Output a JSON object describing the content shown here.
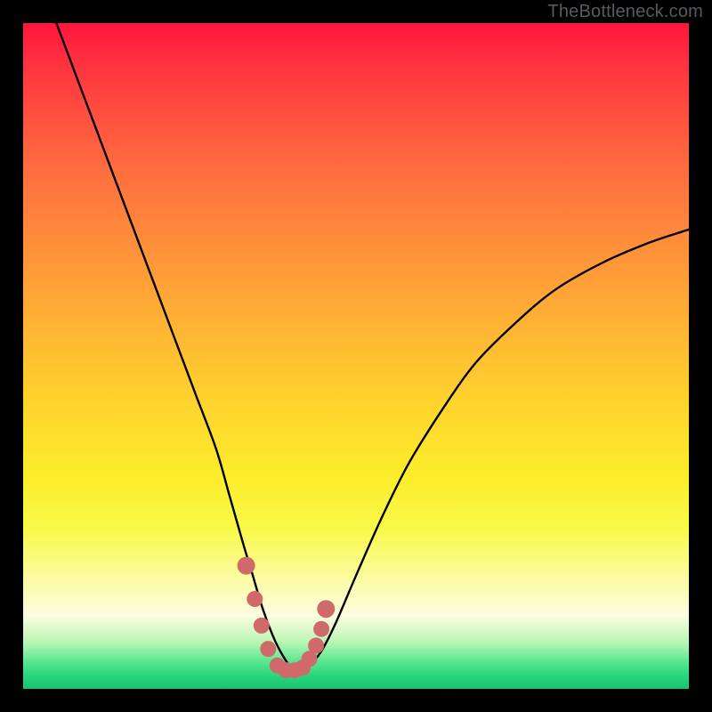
{
  "watermark": "TheBottleneck.com",
  "chart_data": {
    "type": "line",
    "title": "",
    "xlabel": "",
    "ylabel": "",
    "xlim": [
      0,
      100
    ],
    "ylim": [
      0,
      100
    ],
    "series": [
      {
        "name": "bottleneck-curve",
        "color": "#000000",
        "x": [
          5,
          8,
          11,
          14,
          17,
          20,
          23,
          26,
          29,
          31,
          33,
          34.5,
          36,
          37.5,
          39,
          40.5,
          42,
          43.5,
          45,
          47,
          50,
          54,
          58,
          63,
          68,
          74,
          80,
          87,
          94,
          100
        ],
        "y": [
          100,
          92,
          84,
          76,
          68,
          60,
          52,
          44,
          36,
          29,
          22,
          17,
          12,
          8,
          5,
          3,
          3,
          4,
          6,
          10,
          17,
          26,
          34,
          42,
          49,
          55,
          60,
          64,
          67,
          69
        ]
      },
      {
        "name": "optimal-markers",
        "color": "#d06a6a",
        "type": "scatter",
        "x": [
          33.5,
          34.8,
          35.8,
          36.8,
          38.2,
          39.5,
          40.8,
          42.0,
          43.0,
          44.0,
          44.8,
          45.5
        ],
        "y": [
          18.5,
          13.5,
          9.5,
          6.0,
          3.5,
          2.8,
          2.8,
          3.2,
          4.5,
          6.5,
          9.0,
          12.0
        ]
      }
    ]
  }
}
